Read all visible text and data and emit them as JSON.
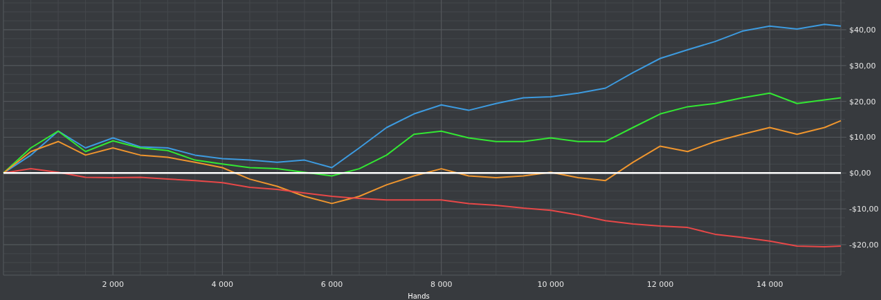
{
  "chart": {
    "chart_data": {
      "type": "line",
      "grid": true,
      "xlabel": "Hands",
      "xlim": [
        0,
        15300
      ],
      "ylim": [
        -28.5,
        48.3
      ],
      "xticks": [
        {
          "value": 2000,
          "label": "2 000"
        },
        {
          "value": 4000,
          "label": "4 000"
        },
        {
          "value": 6000,
          "label": "6 000"
        },
        {
          "value": 8000,
          "label": "8 000"
        },
        {
          "value": 10000,
          "label": "10 000"
        },
        {
          "value": 12000,
          "label": "12 000"
        },
        {
          "value": 14000,
          "label": "14 000"
        }
      ],
      "yticks": [
        {
          "value": 40,
          "label": "$40,00"
        },
        {
          "value": 30,
          "label": "$30,00"
        },
        {
          "value": 20,
          "label": "$20,00"
        },
        {
          "value": 10,
          "label": "$10,00"
        },
        {
          "value": 0,
          "label": "$0,00"
        },
        {
          "value": -10,
          "label": "-$10,00"
        },
        {
          "value": -20,
          "label": "-$20,00"
        }
      ],
      "x": [
        0,
        500,
        1000,
        1500,
        2000,
        2500,
        3000,
        3500,
        4000,
        4500,
        5000,
        5500,
        6000,
        6500,
        7000,
        7500,
        8000,
        8500,
        9000,
        9500,
        10000,
        10500,
        11000,
        11500,
        12000,
        12500,
        13000,
        13500,
        14000,
        14500,
        15000,
        15300
      ],
      "series": [
        {
          "color": "#3d9be0",
          "values": [
            0,
            5,
            11.7,
            7,
            9.8,
            7.3,
            7,
            5,
            4,
            3.6,
            3,
            3.6,
            1.5,
            7,
            12.7,
            16.5,
            19,
            17.5,
            19.4,
            21,
            21.3,
            22.3,
            23.7,
            28,
            32,
            34.4,
            36.7,
            39.6,
            41,
            40.2,
            41.5,
            41
          ]
        },
        {
          "color": "#33e833",
          "values": [
            0,
            7,
            11.7,
            6,
            9,
            7,
            6.3,
            3.6,
            2.5,
            1.5,
            1.2,
            0.2,
            -0.8,
            1.2,
            5,
            10.8,
            11.7,
            9.8,
            8.8,
            8.8,
            9.8,
            8.8,
            8.8,
            12.7,
            16.5,
            18.5,
            19.4,
            21,
            22.3,
            19.4,
            20.4,
            21
          ]
        },
        {
          "color": "#f0962e",
          "values": [
            0,
            6,
            8.8,
            5,
            7,
            5,
            4.4,
            3,
            1.5,
            -1.7,
            -3.7,
            -6.5,
            -8.5,
            -6.5,
            -3.3,
            -0.8,
            1.2,
            -0.8,
            -1.3,
            -0.8,
            0.2,
            -1.3,
            -2.1,
            3,
            7.5,
            6,
            8.8,
            10.8,
            12.7,
            10.8,
            12.7,
            14.6
          ]
        },
        {
          "color": "#e84848",
          "values": [
            0,
            1.2,
            0.2,
            -1.2,
            -1.3,
            -1.2,
            -1.7,
            -2.1,
            -2.7,
            -4,
            -4.6,
            -5.6,
            -6.5,
            -7.1,
            -7.5,
            -7.5,
            -7.5,
            -8.5,
            -9,
            -9.8,
            -10.4,
            -11.7,
            -13.3,
            -14.2,
            -14.8,
            -15.2,
            -17.1,
            -18,
            -19,
            -20.4,
            -20.6,
            -20.4
          ]
        }
      ]
    }
  }
}
